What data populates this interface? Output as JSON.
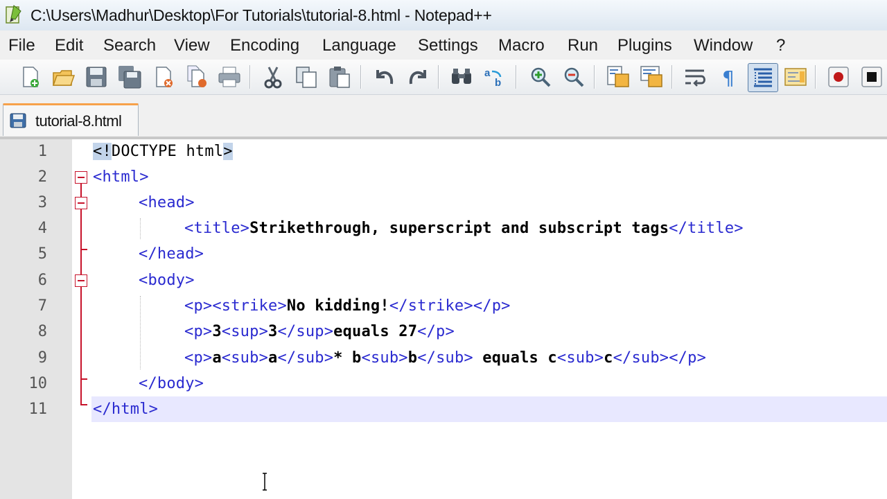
{
  "window": {
    "title": "C:\\Users\\Madhur\\Desktop\\For Tutorials\\tutorial-8.html - Notepad++"
  },
  "menu": {
    "items": [
      "File",
      "Edit",
      "Search",
      "View",
      "Encoding",
      "Language",
      "Settings",
      "Macro",
      "Run",
      "Plugins",
      "Window",
      "?"
    ]
  },
  "toolbar": {
    "icons": [
      "new-file-icon",
      "open-file-icon",
      "save-icon",
      "save-all-icon",
      "close-icon",
      "close-all-icon",
      "print-icon",
      "cut-icon",
      "copy-icon",
      "paste-icon",
      "undo-icon",
      "redo-icon",
      "find-icon",
      "replace-icon",
      "zoom-in-icon",
      "zoom-out-icon",
      "sync-vertical-icon",
      "sync-horizontal-icon",
      "word-wrap-icon",
      "show-all-characters-icon",
      "indent-guide-icon",
      "document-map-icon",
      "record-macro-icon",
      "stop-recording-icon"
    ]
  },
  "tabs": [
    {
      "label": "tutorial-8.html",
      "active": true
    }
  ],
  "editor": {
    "current_line": 11,
    "lines": [
      {
        "num": "1",
        "text": "<!DOCTYPE html>"
      },
      {
        "num": "2",
        "text": "<html>"
      },
      {
        "num": "3",
        "text": "<head>"
      },
      {
        "num": "4",
        "text": "<title>Strikethrough, superscript and subscript tags</title>"
      },
      {
        "num": "5",
        "text": "</head>"
      },
      {
        "num": "6",
        "text": "<body>"
      },
      {
        "num": "7",
        "text": "<p><strike>No kidding!</strike></p>"
      },
      {
        "num": "8",
        "text": "<p>3<sup>3</sup>equals 27</p>"
      },
      {
        "num": "9",
        "text": "<p>a<sub>a</sub>* b<sub>b</sub> equals c<sub>c</sub></p>"
      },
      {
        "num": "10",
        "text": "</body>"
      },
      {
        "num": "11",
        "text": "</html>"
      }
    ]
  },
  "colors": {
    "tag": "#2a2ad0",
    "text": "#000000",
    "fold_marker": "#c7122a",
    "current_line": "#e8e8ff",
    "tab_accent": "#f7a14a"
  }
}
